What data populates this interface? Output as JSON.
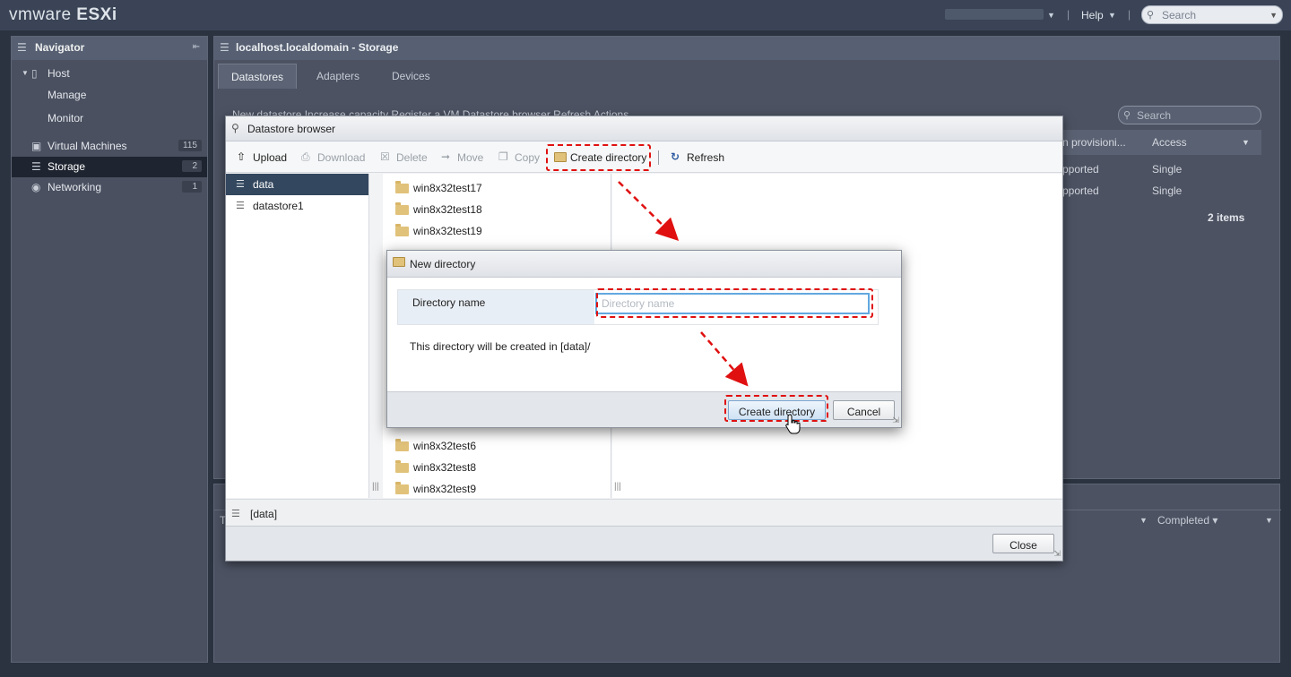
{
  "topbar": {
    "logo_vm": "vmware",
    "logo_esxi": "ESXi",
    "help": "Help",
    "search_placeholder": "Search"
  },
  "navigator": {
    "title": "Navigator",
    "items": [
      {
        "label": "Host",
        "icon": "host-icon"
      },
      {
        "label": "Manage"
      },
      {
        "label": "Monitor"
      },
      {
        "label": "Virtual Machines",
        "badge": "115",
        "icon": "vm-icon"
      },
      {
        "label": "Storage",
        "badge": "2",
        "icon": "storage-icon"
      },
      {
        "label": "Networking",
        "badge": "1",
        "icon": "network-icon"
      }
    ]
  },
  "main": {
    "title": "localhost.localdomain - Storage",
    "tabs": [
      "Datastores",
      "Adapters",
      "Devices"
    ],
    "toolbar": "New datastore   Increase capacity   Register a VM   Datastore browser   Refresh   Actions",
    "search_placeholder": "Search",
    "columns": [
      "n provisioni...",
      "Access"
    ],
    "rows": [
      {
        "prov": "pported",
        "access": "Single"
      },
      {
        "prov": "pported",
        "access": "Single"
      }
    ],
    "count": "2 items"
  },
  "bottom": {
    "completed": "Completed ▾",
    "t_label": "T"
  },
  "datastore_browser": {
    "title": "Datastore browser",
    "toolbar": {
      "upload": "Upload",
      "download": "Download",
      "delete": "Delete",
      "move": "Move",
      "copy": "Copy",
      "create_directory": "Create directory",
      "refresh": "Refresh"
    },
    "datastores": [
      "data",
      "datastore1"
    ],
    "folders_top": [
      "win8x32test17",
      "win8x32test18",
      "win8x32test19"
    ],
    "folders_bottom": [
      "win8x32test6",
      "win8x32test8",
      "win8x32test9"
    ],
    "path": "[data]",
    "close": "Close"
  },
  "new_directory": {
    "title": "New directory",
    "label": "Directory name",
    "placeholder": "Directory name",
    "message": "This directory will be created in [data]/",
    "create": "Create directory",
    "cancel": "Cancel"
  },
  "colors": {
    "highlight": "#e01010",
    "selection": "#33475e",
    "input_focus": "#62a8e0"
  }
}
